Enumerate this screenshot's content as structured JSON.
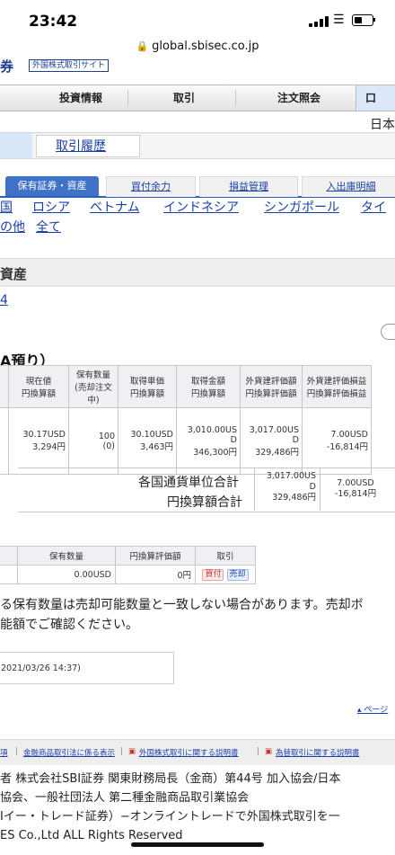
{
  "status_bar": {
    "time": "23:42"
  },
  "url_bar": {
    "domain": "global.sbisec.co.jp"
  },
  "header": {
    "logo": "券",
    "tag": "外国株式取引サイト",
    "nav": [
      "投資情報",
      "取引",
      "注文照会",
      "口"
    ],
    "region": "日本"
  },
  "history_link": "取引履歴",
  "sub_tabs": {
    "active": "保有証券・資産",
    "items": [
      "買付余力",
      "損益管理",
      "入出庫明細"
    ]
  },
  "countries": {
    "row1": [
      "国",
      "ロシア",
      "ベトナム",
      "インドネシア",
      "シンガポール",
      "タイ"
    ],
    "row2": [
      "の他",
      "全て"
    ]
  },
  "section": {
    "title": "資産",
    "link": "4"
  },
  "table_title": "A預り）",
  "holdings": {
    "headers": [
      [
        "国",
        "I"
      ],
      [
        "現在値",
        "円換算額"
      ],
      [
        "保有数量",
        "(売却注文中)"
      ],
      [
        "取得単価",
        "円換算額"
      ],
      [
        "取得金額",
        "円換算額"
      ],
      [
        "外貨建評価額",
        "円換算評価額"
      ],
      [
        "外貨建評価損益",
        "円換算評価損益"
      ]
    ],
    "row": {
      "badge": "イ",
      "price": "30.17USD",
      "price_yen": "3,294円",
      "qty": "100",
      "qty_sell": "(0)",
      "cost_unit": "30.10USD",
      "cost_unit_yen": "3,463円",
      "cost_total_1": "3,010.00US",
      "cost_total_2": "D",
      "cost_total_yen": "346,300円",
      "eval_1": "3,017.00US",
      "eval_2": "D",
      "eval_yen": "329,486円",
      "pl": "7.00USD",
      "pl_yen": "-16,814円"
    }
  },
  "totals": {
    "label_currency": "各国通貨単位合計",
    "label_yen": "円換算額合計",
    "eval_1": "3,017.00US",
    "eval_2": "D",
    "eval_yen": "329,486円",
    "pl": "7.00USD",
    "pl_yen": "-16,814円"
  },
  "cash": {
    "headers": [
      "保有数量",
      "円換算評価額",
      "取引"
    ],
    "qty": "0.00USD",
    "yen": "0円",
    "buy": "買付",
    "sell": "売却"
  },
  "note": {
    "line1": "る保有数量は売却可能数量と一致しない場合があります。売却ボ",
    "line2": "能額でご確認ください。"
  },
  "timestamp": "2021/03/26 14:37)",
  "page_top": "ページ",
  "footer_links": [
    "項",
    "金融商品取引法に係る表示",
    "外国株式取引に関する説明書",
    "為替取引に関する説明書"
  ],
  "footer": {
    "line1": "者 株式会社SBI証券 関東財務局長（金商）第44号 加入協会/日本",
    "line2": "協会、一般社団法人 第二種金融商品取引業協会",
    "line3": "Iイー・トレード証券）−オンライントレードで外国株式取引を一",
    "line4": "ES Co.,Ltd ALL Rights Reserved"
  }
}
